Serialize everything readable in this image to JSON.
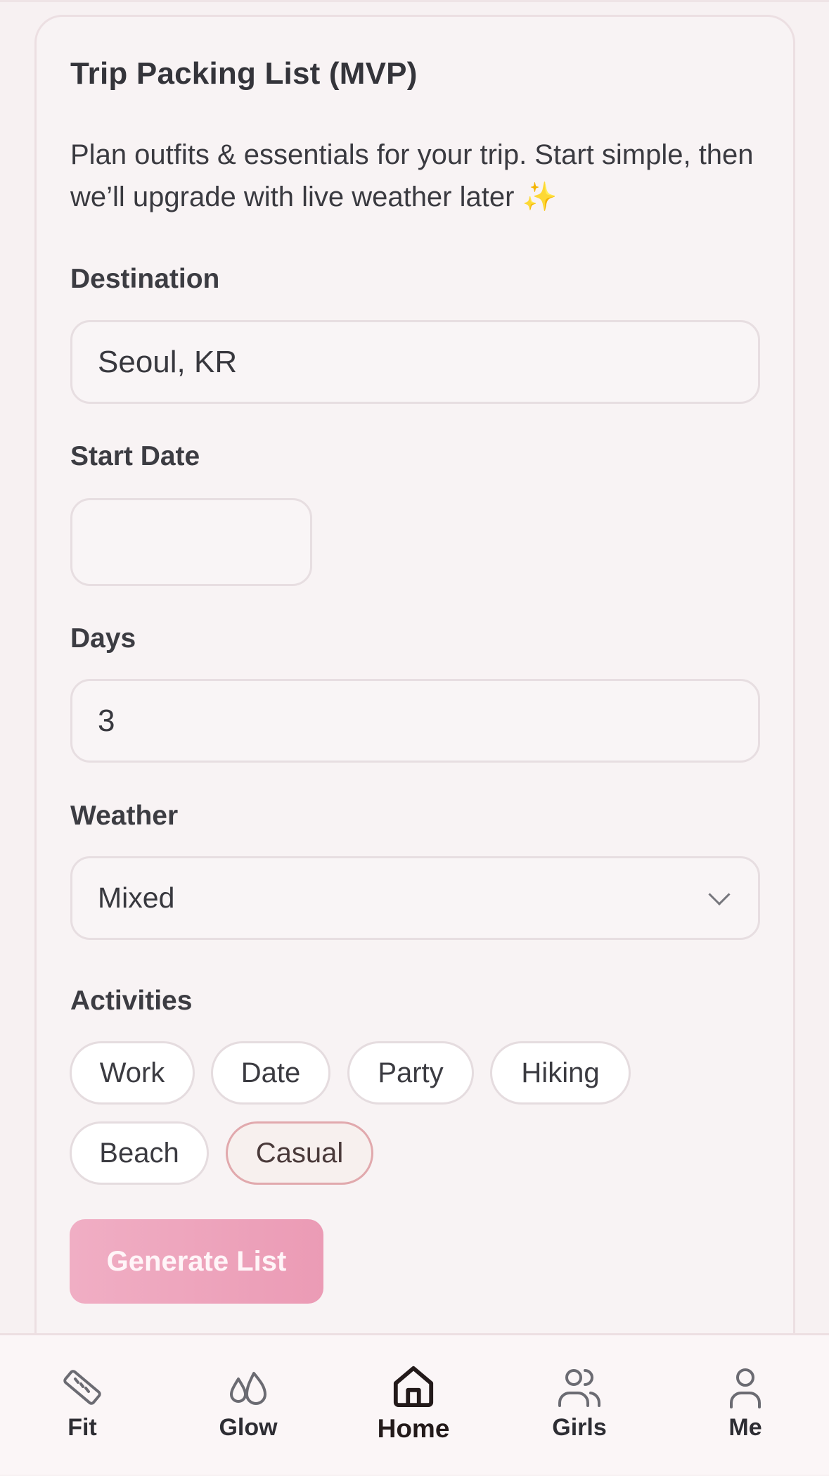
{
  "card": {
    "title": "Trip Packing List (MVP)",
    "description": "Plan outfits & essentials for your trip. Start simple, then we’ll upgrade with live weather later",
    "sparkle": "✨"
  },
  "form": {
    "destination_label": "Destination",
    "destination_value": "Seoul, KR",
    "start_date_label": "Start Date",
    "start_date_value": "",
    "days_label": "Days",
    "days_value": "3",
    "weather_label": "Weather",
    "weather_value": "Mixed",
    "activities_label": "Activities",
    "activities": [
      {
        "label": "Work",
        "selected": false
      },
      {
        "label": "Date",
        "selected": false
      },
      {
        "label": "Party",
        "selected": false
      },
      {
        "label": "Hiking",
        "selected": false
      },
      {
        "label": "Beach",
        "selected": false
      },
      {
        "label": "Casual",
        "selected": true
      }
    ],
    "generate_label": "Generate List"
  },
  "tabbar": {
    "items": [
      {
        "label": "Fit",
        "icon": "ruler-icon"
      },
      {
        "label": "Glow",
        "icon": "droplets-icon"
      },
      {
        "label": "Home",
        "icon": "home-icon",
        "active": true
      },
      {
        "label": "Girls",
        "icon": "users-icon"
      },
      {
        "label": "Me",
        "icon": "user-icon"
      }
    ]
  },
  "colors": {
    "background": "#f7f1f2",
    "accent_pink": "#eb9bb5",
    "active_chip_border": "#e1a9ad"
  }
}
